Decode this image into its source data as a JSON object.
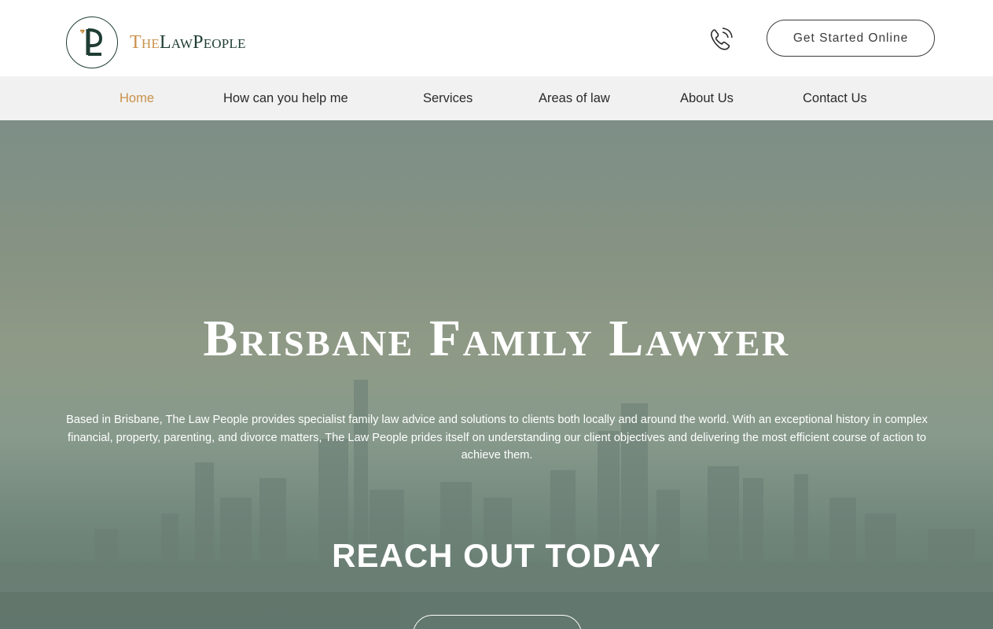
{
  "brand": {
    "logo_monogram": "TLP",
    "name_part1": "The",
    "name_part2": "LawPeople"
  },
  "header": {
    "phone_icon": "phone-ringing-icon",
    "cta_label": "Get Started Online"
  },
  "nav": {
    "items": [
      {
        "label": "Home",
        "active": true
      },
      {
        "label": "How can you help me",
        "active": false
      },
      {
        "label": "Services",
        "active": false
      },
      {
        "label": "Areas of law",
        "active": false
      },
      {
        "label": "About Us",
        "active": false
      },
      {
        "label": "Contact Us",
        "active": false
      }
    ]
  },
  "hero": {
    "title": "Brisbane Family Lawyer",
    "description": "Based in Brisbane, The Law People provides specialist family law advice and solutions to clients both locally and around the world. With an exceptional history in complex financial, property, parenting, and divorce matters, The Law People prides itself on understanding our client objectives and delivering the most efficient course of action to achieve them.",
    "subheading": "REACH OUT TODAY",
    "background": "brisbane-city-skyline-photo"
  },
  "colors": {
    "accent": "#c9914a",
    "brand_dark": "#1f3d34",
    "nav_bg": "#f1f1f1",
    "hero_overlay": "#7d8f87"
  }
}
